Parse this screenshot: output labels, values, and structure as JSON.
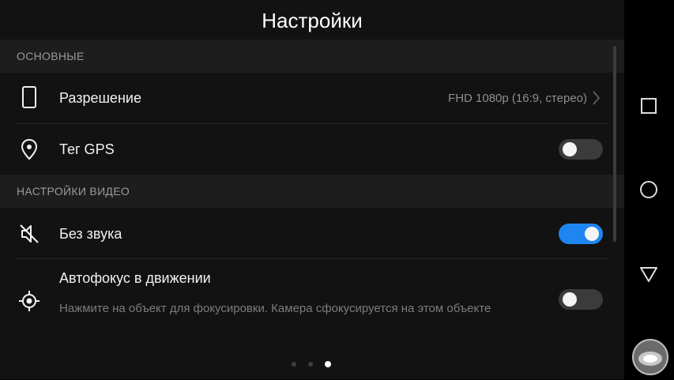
{
  "header": {
    "title": "Настройки"
  },
  "sections": [
    {
      "title": "ОСНОВНЫЕ"
    },
    {
      "title": "НАСТРОЙКИ ВИДЕО"
    }
  ],
  "settings": {
    "resolution": {
      "label": "Разрешение",
      "value": "FHD 1080p (16:9, стерео)",
      "icon": "phone-outline-icon"
    },
    "gps": {
      "label": "Тег GPS",
      "enabled": false,
      "icon": "location-pin-icon"
    },
    "mute": {
      "label": "Без звука",
      "enabled": true,
      "icon": "speaker-muted-icon"
    },
    "autofocus": {
      "label": "Автофокус в движении",
      "description": "Нажмите на объект для фокусировки. Камера сфокусируется на этом объекте",
      "enabled": false,
      "icon": "focus-target-icon"
    }
  },
  "page_indicator": {
    "total": 3,
    "active": 3
  },
  "navigation": {
    "buttons": [
      "recents-square-icon",
      "home-circle-icon",
      "back-triangle-icon"
    ]
  },
  "colors": {
    "accent": "#1e86f0",
    "background": "#121212",
    "section_bg": "#1d1d1d"
  }
}
